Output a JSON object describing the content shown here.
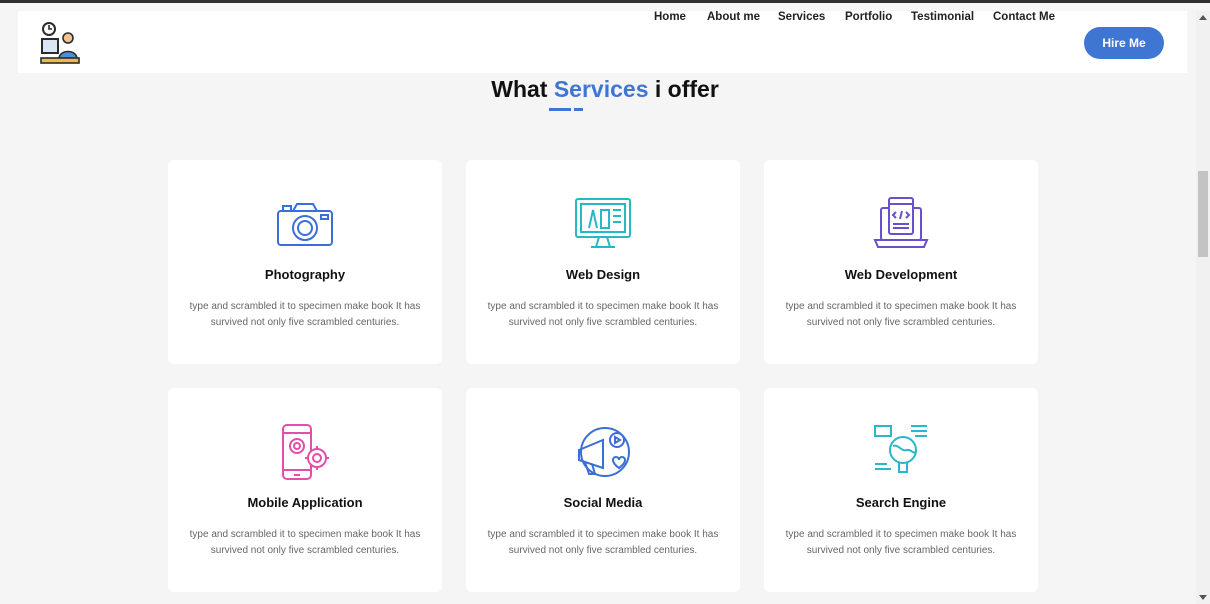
{
  "nav": {
    "links": [
      "Home",
      "About me",
      "Services",
      "Portfolio",
      "Testimonial",
      "Contact Me"
    ],
    "hire_label": "Hire Me"
  },
  "section": {
    "title_part1": "What",
    "title_accent": "Services",
    "title_part2": "i offer"
  },
  "services": [
    {
      "title": "Photography",
      "icon": "camera-icon",
      "desc": "type and scrambled it to specimen make book It has survived not only five scrambled centuries."
    },
    {
      "title": "Web Design",
      "icon": "monitor-design-icon",
      "desc": "type and scrambled it to specimen make book It has survived not only five scrambled centuries."
    },
    {
      "title": "Web Development",
      "icon": "laptop-code-icon",
      "desc": "type and scrambled it to specimen make book It has survived not only five scrambled centuries."
    },
    {
      "title": "Mobile Application",
      "icon": "phone-gears-icon",
      "desc": "type and scrambled it to specimen make book It has survived not only five scrambled centuries."
    },
    {
      "title": "Social Media",
      "icon": "megaphone-social-icon",
      "desc": "type and scrambled it to specimen make book It has survived not only five scrambled centuries."
    },
    {
      "title": "Search Engine",
      "icon": "magnifier-globe-icon",
      "desc": "type and scrambled it to specimen make book It has survived not only five scrambled centuries."
    }
  ],
  "colors": {
    "accent": "#3f76d3",
    "camera": "#3a6fd8",
    "design": "#27b8c6",
    "dev": "#6a4fd0",
    "mobile": "#e04fa8",
    "social": "#3a6fd8",
    "seo": "#2ab7c9"
  }
}
